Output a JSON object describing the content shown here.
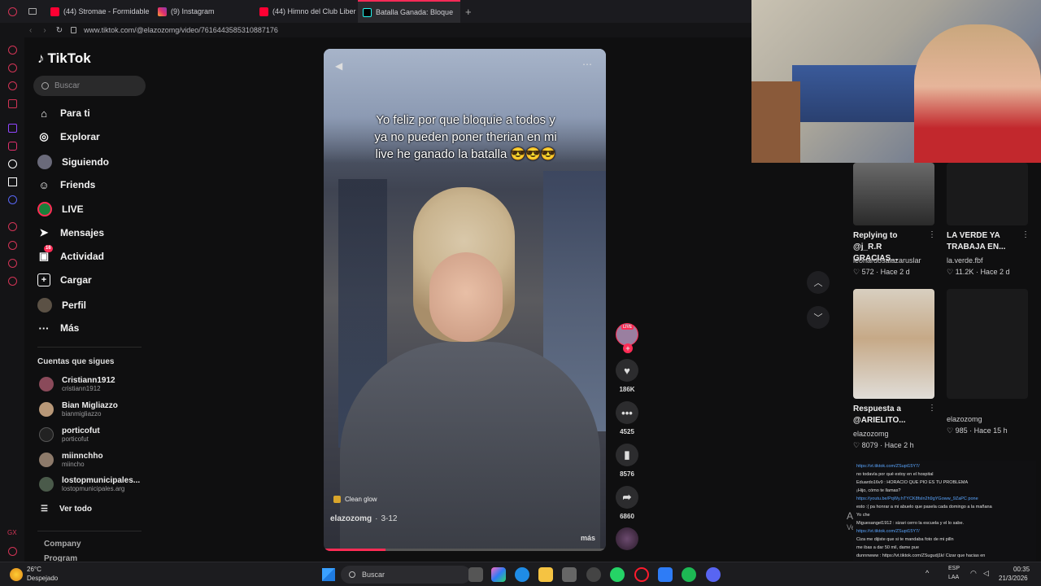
{
  "tabs": [
    {
      "label": "(44) Stromae - Formidable",
      "color": "#ff0033"
    },
    {
      "label": "(9) Instagram",
      "color": "#e1306c"
    },
    {
      "label": "(44) Himno del Club Liber",
      "color": "#ff0033"
    },
    {
      "label": "Batalla Ganada: Bloque",
      "color": "#25f4ee"
    }
  ],
  "address": {
    "url": "www.tiktok.com/@elazozomg/video/7616443585310887176"
  },
  "brand": {
    "logo": "TikTok"
  },
  "search": {
    "placeholder": "Buscar"
  },
  "nav": [
    {
      "label": "Para ti",
      "icon": "home-icon"
    },
    {
      "label": "Explorar",
      "icon": "compass-icon"
    },
    {
      "label": "Siguiendo",
      "icon": "following-icon"
    },
    {
      "label": "Friends",
      "icon": "friends-icon"
    },
    {
      "label": "LIVE",
      "icon": "live-icon"
    },
    {
      "label": "Mensajes",
      "icon": "messages-icon"
    },
    {
      "label": "Actividad",
      "icon": "activity-icon",
      "badge": "16"
    },
    {
      "label": "Cargar",
      "icon": "upload-icon"
    },
    {
      "label": "Perfil",
      "icon": "profile-icon"
    },
    {
      "label": "Más",
      "icon": "more-icon"
    }
  ],
  "following": {
    "heading": "Cuentas que sigues",
    "accounts": [
      {
        "name": "Cristiann1912",
        "handle": "cristiann1912"
      },
      {
        "name": "Bian Migliazzo",
        "handle": "bianmigliazzo"
      },
      {
        "name": "porticofut",
        "handle": "porticofut"
      },
      {
        "name": "miinnchho",
        "handle": "miincho"
      },
      {
        "name": "lostopmunicipales...",
        "handle": "lostopmunicipales.arg"
      }
    ],
    "see_all": "Ver todo"
  },
  "footer": {
    "company": "Company",
    "program": "Program"
  },
  "video": {
    "caption": "Yo feliz por que bloquie a todos y ya no pueden poner therian en mi live he ganado la batalla 😎😎😎",
    "effect": "Clean glow",
    "author": "elazozomg",
    "date": "3-12",
    "more": "más",
    "live_badge": "LIVE"
  },
  "actions": {
    "likes": "186K",
    "comments": "4525",
    "saves": "8576",
    "shares": "6860"
  },
  "related": [
    {
      "title": "Replying to @j_R.R GRACIAS...",
      "user": "leonardosalazaruslar",
      "likes": "572",
      "age": "Hace 2 d"
    },
    {
      "title": "LA VERDE YA TRABAJA EN...",
      "user": "la.verde.fbf",
      "likes": "11.2K",
      "age": "Hace 2 d"
    },
    {
      "title": "Respuesta a @ARIELITO...",
      "user": "elazozomg",
      "likes": "8079",
      "age": "Hace 2 h"
    },
    {
      "title": "",
      "user": "elazozomg",
      "likes": "985",
      "age": "Hace 15 h"
    }
  ],
  "activate_windows": {
    "line1": "Activa",
    "line2": "Ve a Con"
  },
  "chat": [
    "https://vt.tiktok.com/ZSupt15Y7/",
    "no todavía por qué estoy en el hospital",
    "Eduardo16v9 : HORACIO QUE PIO ES TU PROBLEMA",
    "¡Hijo, cómo te llamas?",
    "https://youtu.be/PqWy.hTYCK8fsIn2h9gYGoww_9ZaPC pone",
    "esto :( pa honrar a mi abuelo que pasela cada domingo a la mañana",
    "Yo che",
    "Miguesangel1912 : sizari cerro la escuela y el lo sabe.",
    "https://vt.tiktok.com/ZSupt15Y7/",
    "Ciza me dijiste que si te mandaba foto de mi pilln",
    "me ibas a dar 50 mil, dame pue",
    "dunnnwww : https://vt.tiktok.com/ZSugudj1k/ Cizar que hacias en",
    "Multipizza?",
    "Eduardo16v9 : SE LLAMA TRABA",
    "Fecu_26383 : bnlm*"
  ],
  "taskbar": {
    "weather_temp": "26°C",
    "weather_desc": "Despejado",
    "search": "Buscar",
    "lang1": "ESP",
    "lang2": "LAA",
    "time": "00:35",
    "date": "21/3/2026"
  }
}
